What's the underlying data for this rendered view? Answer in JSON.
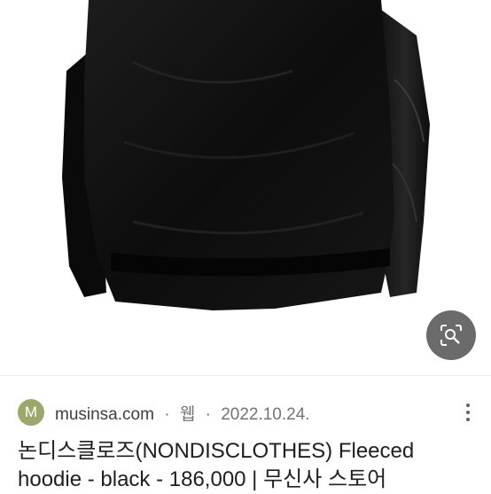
{
  "result": {
    "favicon_letter": "M",
    "source_domain": "musinsa.com",
    "separator": "·",
    "type_label": "웹",
    "date": "2022.10.24.",
    "title": "논디스클로즈(NONDISCLOTHES) Fleeced hoodie - black - 186,000 | 무신사 스토어"
  },
  "image": {
    "subject": "black fleece hoodie",
    "background_color": "#ffffff",
    "garment_color": "#111111"
  },
  "icons": {
    "visual_search": "lens-search-icon",
    "more": "more-vert-icon"
  },
  "colors": {
    "favicon_bg": "#9aa86b",
    "lens_button_bg": "#6b6b6b",
    "title_text": "#1f1f1f",
    "meta_text": "#70757a"
  }
}
